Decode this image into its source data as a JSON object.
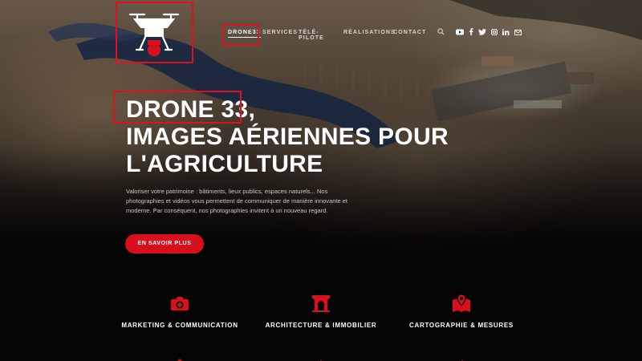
{
  "brand": {
    "name": "DRONE 33",
    "nav_label": "DRONE33",
    "accent_color": "#d8101e"
  },
  "nav": {
    "items": [
      {
        "label": "DRONE33",
        "active": true
      },
      {
        "label": "SERVICES",
        "active": false
      },
      {
        "label": "TÉLÉ-PILOTE",
        "active": false
      },
      {
        "label": "RÉALISATIONS",
        "active": false
      },
      {
        "label": "CONTACT",
        "active": false
      }
    ],
    "icons": [
      "search-icon",
      "youtube-icon",
      "facebook-icon",
      "twitter-icon",
      "instagram-icon",
      "linkedin-icon",
      "email-icon"
    ]
  },
  "hero": {
    "headline_lines": [
      "DRONE 33,",
      "IMAGES AÉRIENNES POUR",
      "L'AGRICULTURE"
    ],
    "lead": "Valoriser votre patrimoine : bâtiments, lieux publics, espaces naturels... Nos photographies et vidéos vous permettent de communiquer de manière innovante et moderne. Par conséquent, nos photographies invitent à un nouveau regard.",
    "cta_label": "EN SAVOIR PLUS"
  },
  "services": [
    {
      "label": "MARKETING & COMMUNICATION",
      "icon": "camera-icon"
    },
    {
      "label": "ARCHITECTURE & IMMOBILIER",
      "icon": "building-icon"
    },
    {
      "label": "CARTOGRAPHIE & MESURES",
      "icon": "map-icon"
    }
  ]
}
